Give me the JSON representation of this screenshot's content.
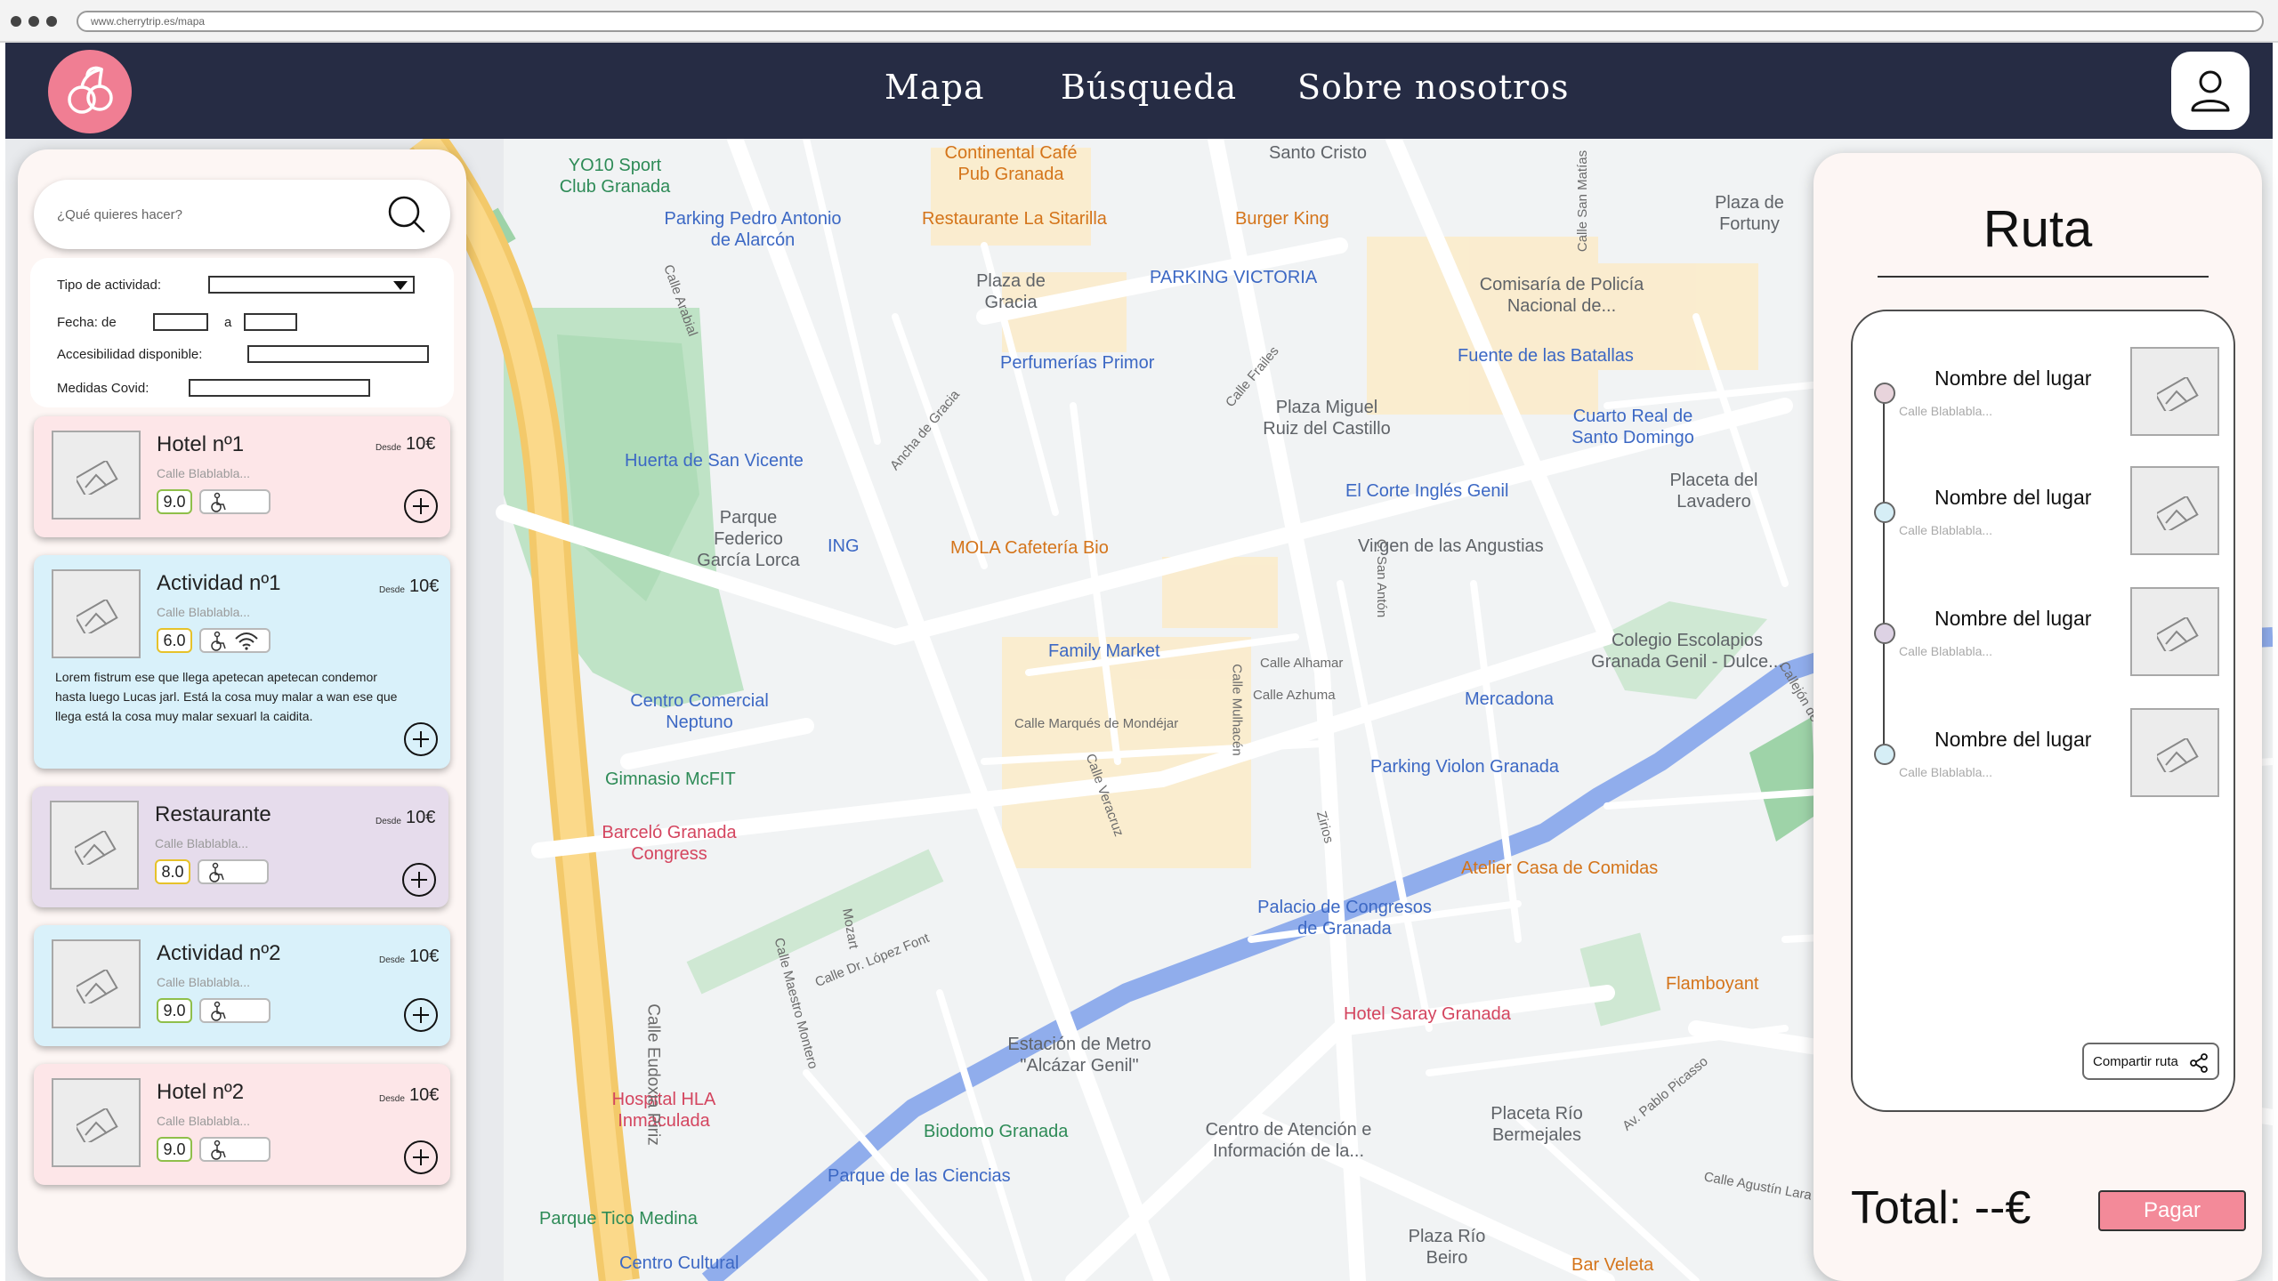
{
  "browser": {
    "url": "www.cherrytrip.es/mapa"
  },
  "nav": {
    "links": [
      "Mapa",
      "Búsqueda",
      "Sobre nosotros"
    ]
  },
  "colors": {
    "navbar": "#262c44",
    "accent": "#f07e93",
    "pay": "#f38a99"
  },
  "search": {
    "placeholder": "¿Qué quieres hacer?"
  },
  "filters": {
    "activity_type": "Tipo de actividad:",
    "date_from": "Fecha: de",
    "date_to": "a",
    "accessibility": "Accesibilidad disponible:",
    "covid": "Medidas Covid:"
  },
  "cards": [
    {
      "title": "Hotel nº1",
      "address": "Calle Blablabla...",
      "from": "Desde",
      "price": "10€",
      "rating": "9.0",
      "color": "pink"
    },
    {
      "title": "Actividad nº1",
      "address": "Calle Blablabla...",
      "from": "Desde",
      "price": "10€",
      "rating": "6.0",
      "color": "blue",
      "description": "Lorem fistrum ese que llega apetecan apetecan condemor hasta luego Lucas jarl. Está la cosa muy malar a wan ese que llega está la cosa muy malar sexuarl la caidita."
    },
    {
      "title": "Restaurante",
      "address": "Calle Blablabla...",
      "from": "Desde",
      "price": "10€",
      "rating": "8.0",
      "color": "purple"
    },
    {
      "title": "Actividad nº2",
      "address": "Calle Blablabla...",
      "from": "Desde",
      "price": "10€",
      "rating": "9.0",
      "color": "blue"
    },
    {
      "title": "Hotel nº2",
      "address": "Calle Blablabla...",
      "from": "Desde",
      "price": "10€",
      "rating": "9.0",
      "color": "pink"
    }
  ],
  "route": {
    "title": "Ruta",
    "stops": [
      {
        "name": "Nombre del lugar",
        "address": "Calle Blablabla...",
        "dot": "#e8d4dc"
      },
      {
        "name": "Nombre del lugar",
        "address": "Calle Blablabla...",
        "dot": "#d6eef6"
      },
      {
        "name": "Nombre del lugar",
        "address": "Calle Blablabla...",
        "dot": "#ddd2e4"
      },
      {
        "name": "Nombre del lugar",
        "address": "Calle Blablabla...",
        "dot": "#d6eef6"
      }
    ],
    "share": "Compartir ruta",
    "total": "Total: --€",
    "pay": "Pagar"
  },
  "map_labels": [
    "YO10 Sport Club Granada",
    "Continental Café Pub Granada",
    "Santo Cristo",
    "Plaza de Fortuny",
    "Parking Pedro Antonio de Alarcón",
    "Restaurante La Sitarilla",
    "Burger King",
    "Plaza de Gracia",
    "PARKING VICTORIA",
    "Comisaría de Policía Nacional de...",
    "Perfumerías Primor",
    "Fuente de las Batallas",
    "Plaza Miguel Ruiz del Castillo",
    "Cuarto Real de Santo Domingo",
    "Huerta de San Vicente",
    "Parque Federico García Lorca",
    "El Corte Inglés Genil",
    "Placeta del Lavadero",
    "ING",
    "MOLA Cafetería Bio",
    "Virgen de las Angustias",
    "Family Market",
    "Colegio Escolapios Granada Genil - Dulce...",
    "Centro Comercial Neptuno",
    "Mercadona",
    "Parking Violon Granada",
    "Gimnasio McFIT",
    "Barceló Granada Congress",
    "Atelier Casa de Comidas",
    "Palacio de Congresos de Granada",
    "Flamboyant",
    "Hotel Saray Granada",
    "Estación de Metro \"Alcázar Genil\"",
    "Hospital HLA Inmaculada",
    "Biodomo Granada",
    "Centro de Atención e Información de la...",
    "Placeta Río Bermejales",
    "Parque de las Ciencias",
    "Parque Tico Medina",
    "Centro Cultural",
    "Plaza Río Beiro",
    "Bar Veleta"
  ],
  "map_streets": [
    "Calle Arabial",
    "Calle Frailes",
    "Ancha de Gracia",
    "Calle Alhamar",
    "Calle Azhuma",
    "Calle Marqués de Mondéjar",
    "Calle Veracruz",
    "Calle Mulhacén",
    "C. San Antón",
    "Calle Eudoxia Piriz",
    "Calle Maestro Montero",
    "Calle Dr. López Font",
    "Mozart",
    "Zirios",
    "Av. Pablo Picasso",
    "Calle Agustín Lara",
    "Calle San Matías",
    "Callejón de"
  ]
}
